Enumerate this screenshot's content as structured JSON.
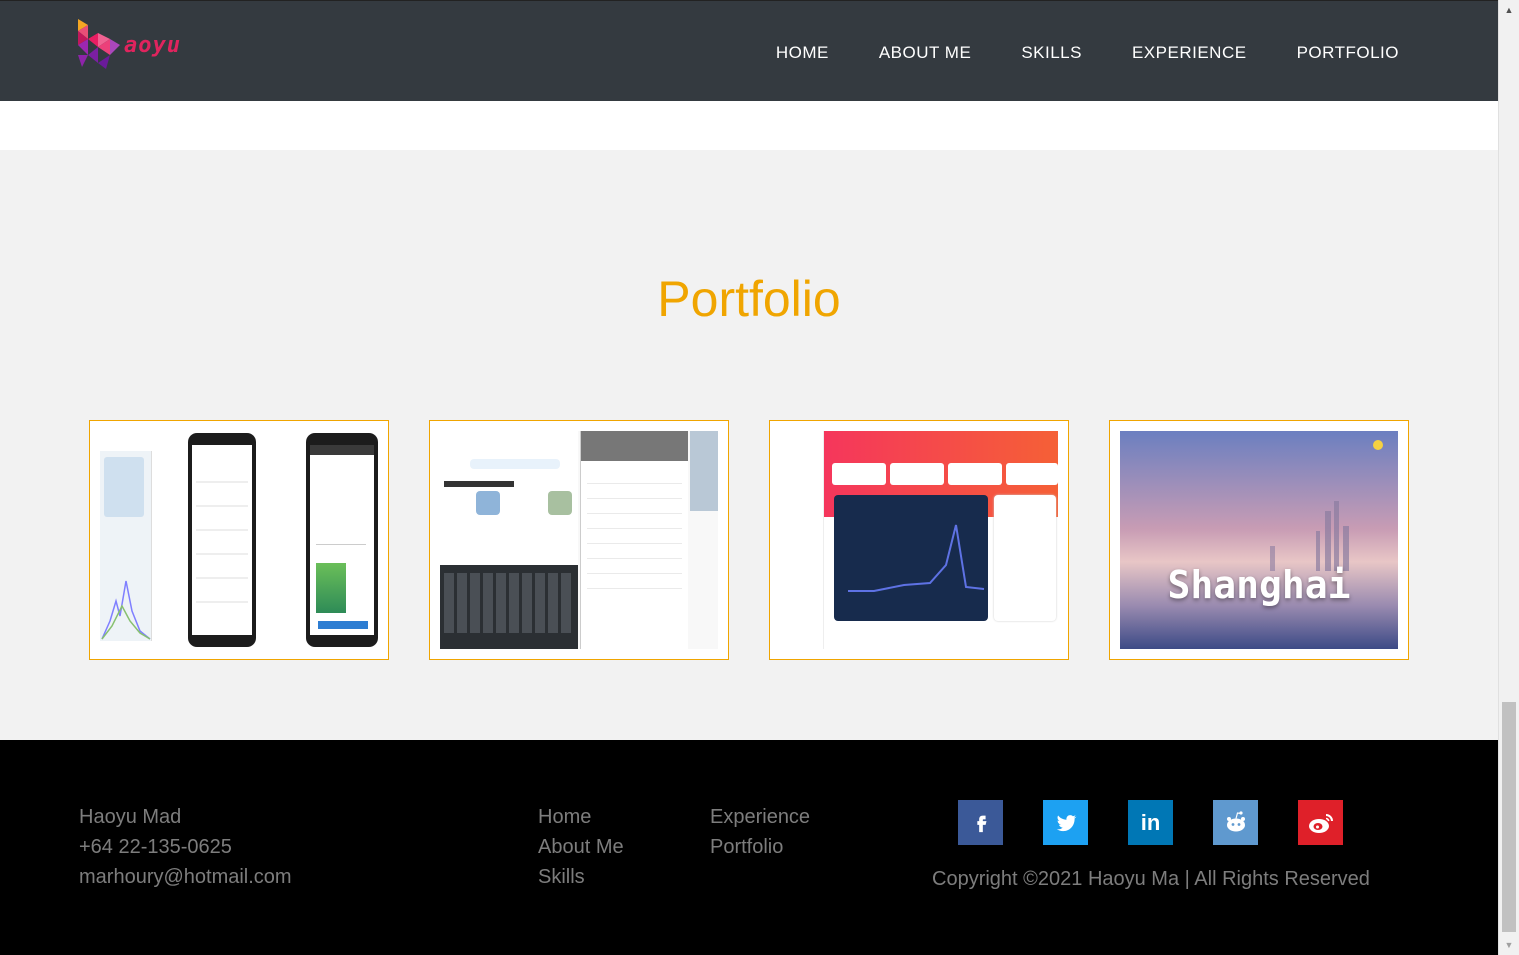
{
  "logo": {
    "text": "aoyu",
    "icon": "haoyu-logo-icon"
  },
  "nav": {
    "items": [
      "HOME",
      "ABOUT ME",
      "SKILLS",
      "EXPERIENCE",
      "PORTFOLIO"
    ]
  },
  "portfolio": {
    "title": "Portfolio",
    "cards": [
      {
        "name": "covid-dashboard-app",
        "thumb_text": ""
      },
      {
        "name": "travel-guide-app",
        "thumb_text": ""
      },
      {
        "name": "admin-dashboard",
        "thumb_text": ""
      },
      {
        "name": "shanghai-site",
        "thumb_text": "Shanghai"
      }
    ]
  },
  "footer": {
    "contact": {
      "name": "Haoyu Mad",
      "phone": "+64 22-135-0625",
      "email": "marhoury@hotmail.com"
    },
    "links_col1": [
      "Home",
      "About Me",
      "Skills"
    ],
    "links_col2": [
      "Experience",
      "Portfolio"
    ],
    "socials": [
      {
        "icon": "facebook-icon",
        "glyph": "f",
        "color": "#3b5998"
      },
      {
        "icon": "twitter-icon",
        "glyph": "🐦",
        "color": "#1da1f2"
      },
      {
        "icon": "linkedin-icon",
        "glyph": "in",
        "color": "#0077b5"
      },
      {
        "icon": "reddit-icon",
        "glyph": "👽",
        "color": "#5f99cf"
      },
      {
        "icon": "weibo-icon",
        "glyph": "微",
        "color": "#df2029"
      }
    ],
    "copyright": "Copyright ©2021 Haoyu Ma | All Rights Reserved"
  },
  "colors": {
    "accent": "#f0a500",
    "navbar": "#343a40",
    "footer": "#000000"
  }
}
